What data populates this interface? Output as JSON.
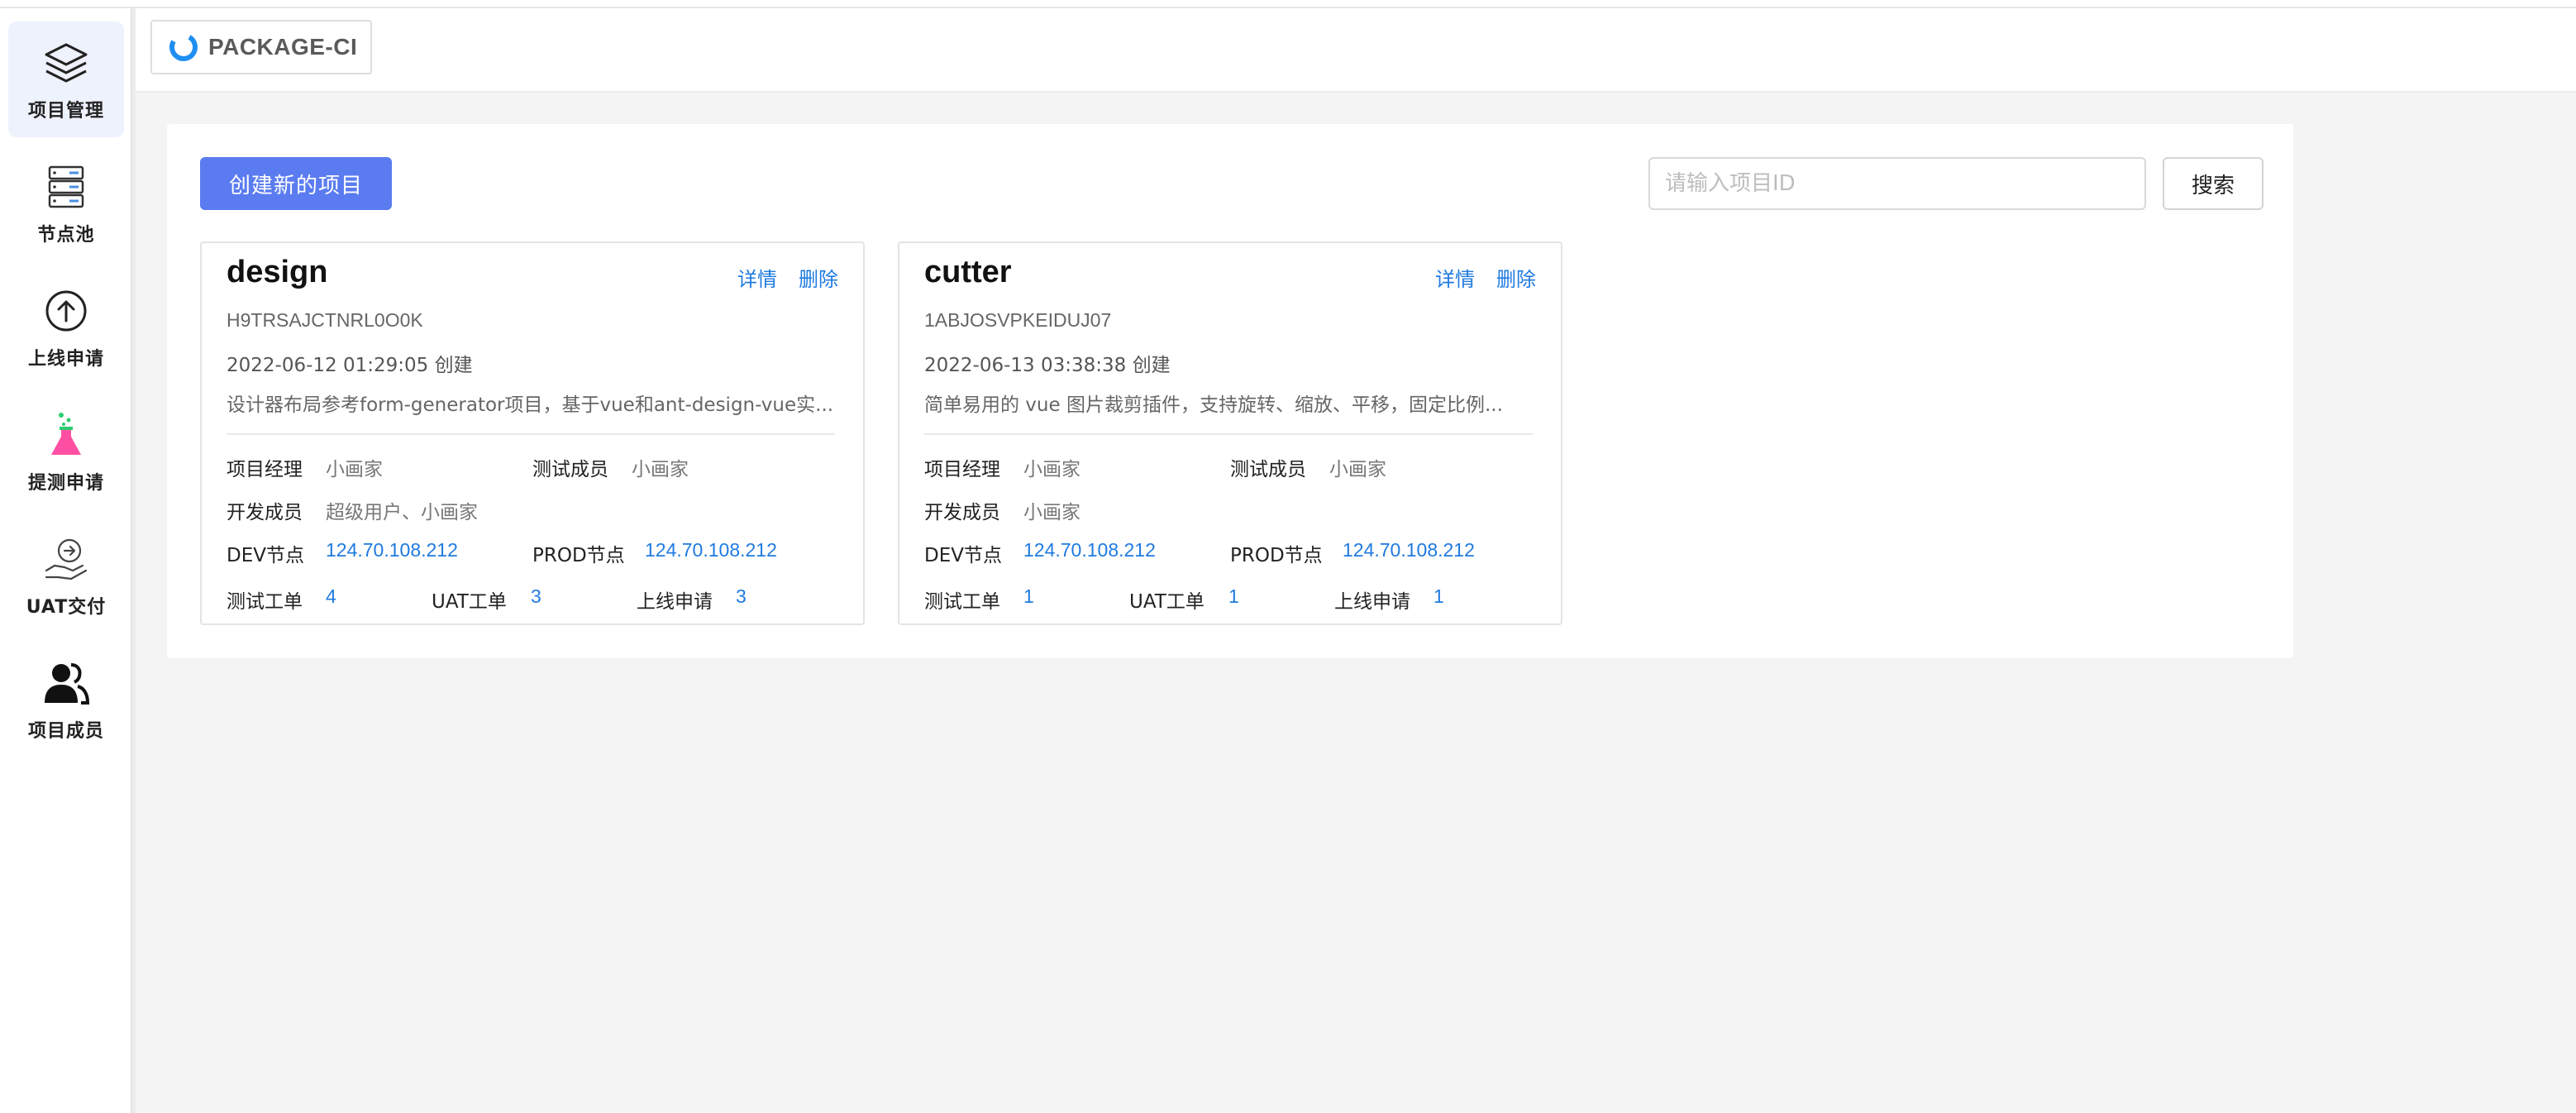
{
  "sidebar": {
    "items": [
      {
        "label": "项目管理",
        "icon": "layers-icon",
        "active": true
      },
      {
        "label": "节点池",
        "icon": "server-icon",
        "active": false
      },
      {
        "label": "上线申请",
        "icon": "upload-circle-icon",
        "active": false
      },
      {
        "label": "提测申请",
        "icon": "flask-icon",
        "active": false
      },
      {
        "label": "UAT交付",
        "icon": "hand-delivery-icon",
        "active": false
      },
      {
        "label": "项目成员",
        "icon": "members-icon",
        "active": false
      }
    ]
  },
  "header": {
    "brand": "PACKAGE-CI"
  },
  "toolbar": {
    "create_label": "创建新的项目",
    "search_placeholder": "请输入项目ID",
    "search_value": "",
    "search_label": "搜索"
  },
  "labels": {
    "detail": "详情",
    "delete": "删除",
    "manager": "项目经理",
    "tester": "测试成员",
    "developer": "开发成员",
    "dev_node": "DEV节点",
    "prod_node": "PROD节点",
    "test_orders": "测试工单",
    "uat_orders": "UAT工单",
    "release_requests": "上线申请"
  },
  "projects": [
    {
      "name": "design",
      "id": "H9TRSAJCTNRL0O0K",
      "created": "2022-06-12 01:29:05 创建",
      "description": "设计器布局参考form-generator项目，基于vue和ant-design-vue实...",
      "manager": "小画家",
      "tester": "小画家",
      "developers": "超级用户、小画家",
      "dev_node": "124.70.108.212",
      "prod_node": "124.70.108.212",
      "test_orders": "4",
      "uat_orders": "3",
      "release_requests": "3"
    },
    {
      "name": "cutter",
      "id": "1ABJOSVPKEIDUJ07",
      "created": "2022-06-13 03:38:38 创建",
      "description": "简单易用的 vue 图片裁剪插件，支持旋转、缩放、平移，固定比例...",
      "manager": "小画家",
      "tester": "小画家",
      "developers": "小画家",
      "dev_node": "124.70.108.212",
      "prod_node": "124.70.108.212",
      "test_orders": "1",
      "uat_orders": "1",
      "release_requests": "1"
    }
  ],
  "colors": {
    "primary": "#5b7cf0",
    "link": "#1f7ae0",
    "active_nav_bg": "#eef2fd"
  }
}
